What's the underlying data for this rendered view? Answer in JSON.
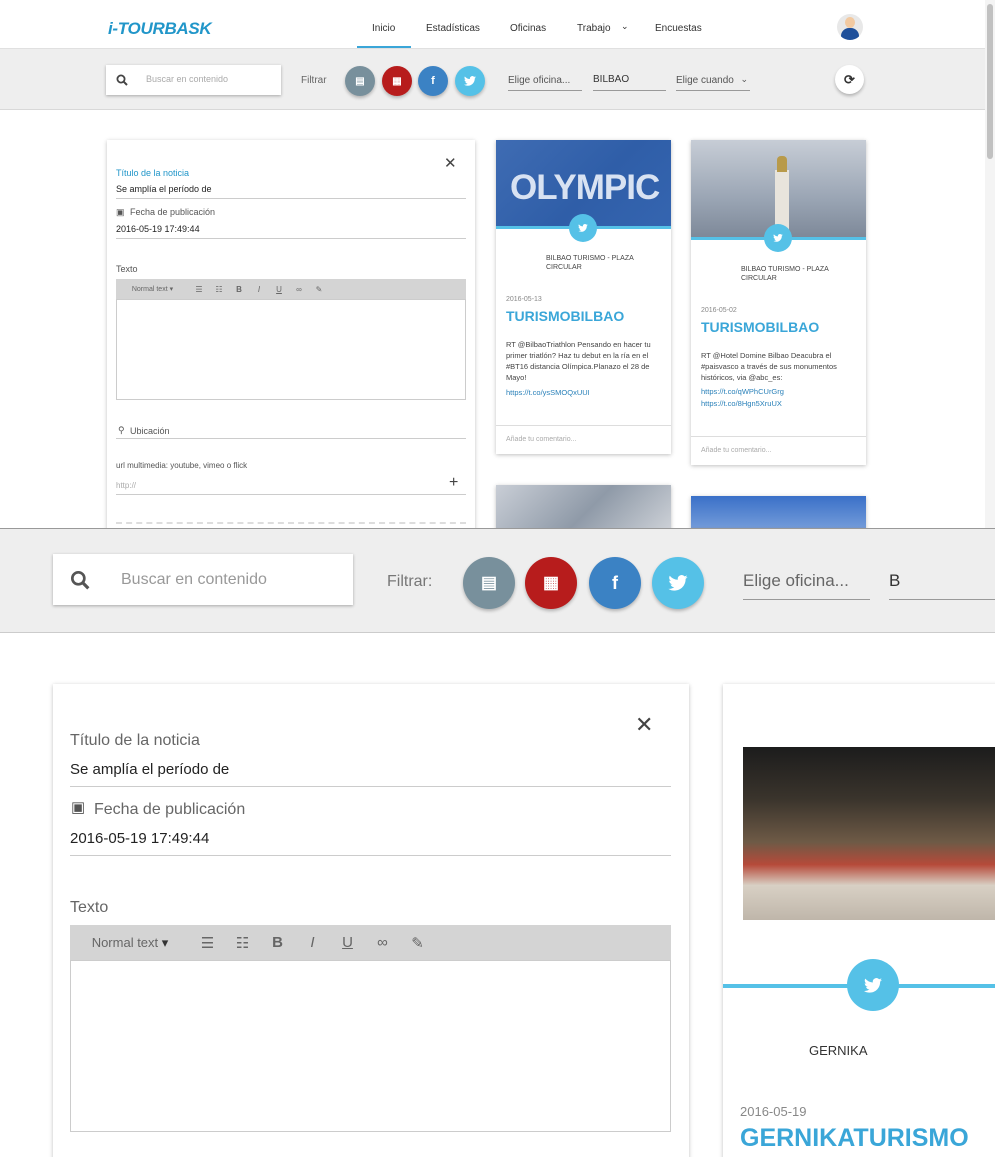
{
  "header": {
    "logo": "i-TOURBASK",
    "nav": [
      {
        "label": "Inicio",
        "active": true
      },
      {
        "label": "Estadísticas"
      },
      {
        "label": "Oficinas"
      },
      {
        "label": "Trabajo"
      },
      {
        "label": "Encuestas"
      }
    ]
  },
  "toolbar": {
    "search_placeholder": "Buscar en contenido",
    "filter_label": "Filtrar",
    "filter_label_zoom": "Filtrar:",
    "filters": [
      {
        "icon": "newspaper-icon",
        "color": "#78909c"
      },
      {
        "icon": "calendar-icon",
        "color": "#b71c1c"
      },
      {
        "icon": "facebook-icon",
        "color": "#3b82c4"
      },
      {
        "icon": "twitter-icon",
        "color": "#55c1e7"
      }
    ],
    "office_placeholder": "Elige oficina...",
    "office_value": "BILBAO",
    "office_value_zoom": "B",
    "when_placeholder": "Elige cuando"
  },
  "form": {
    "title_label": "Título de la noticia",
    "title_value": "Se amplía el período de",
    "date_label": "Fecha de publicación",
    "date_value": "2016-05-19 17:49:44",
    "text_label": "Texto",
    "editor_format": "Normal text",
    "location_label": "Ubicación",
    "media_label": "url multimedia: youtube, vimeo o flick",
    "media_placeholder": "http://"
  },
  "cards": [
    {
      "image_text": "OLYMPIC",
      "source": "BILBAO TURISMO - PLAZA CIRCULAR",
      "date": "2016-05-13",
      "author": "TURISMOBILBAO",
      "text": "RT @BilbaoTriathlon Pensando en hacer tu primer triatlón? Haz tu debut en la ría en el #BT16 distancia Olímpica.Planazo el 28 de Mayo!",
      "link": "https://t.co/ysSMOQxUUI",
      "comment_placeholder": "Añade tu comentario..."
    },
    {
      "source": "BILBAO TURISMO - PLAZA CIRCULAR",
      "date": "2016-05-02",
      "author": "TURISMOBILBAO",
      "text": "RT @Hotel Domine Bilbao Deacubra el #paisvasco a través de sus monumentos históricos, via @abc_es:",
      "link1": "https://t.co/qWPhCUrGrg",
      "link2": "https://t.co/8Hgn5XruUX",
      "comment_placeholder": "Añade tu comentario..."
    },
    {
      "source": "GERNIKA",
      "date": "2016-05-19",
      "author": "GERNIKATURISMO"
    }
  ]
}
